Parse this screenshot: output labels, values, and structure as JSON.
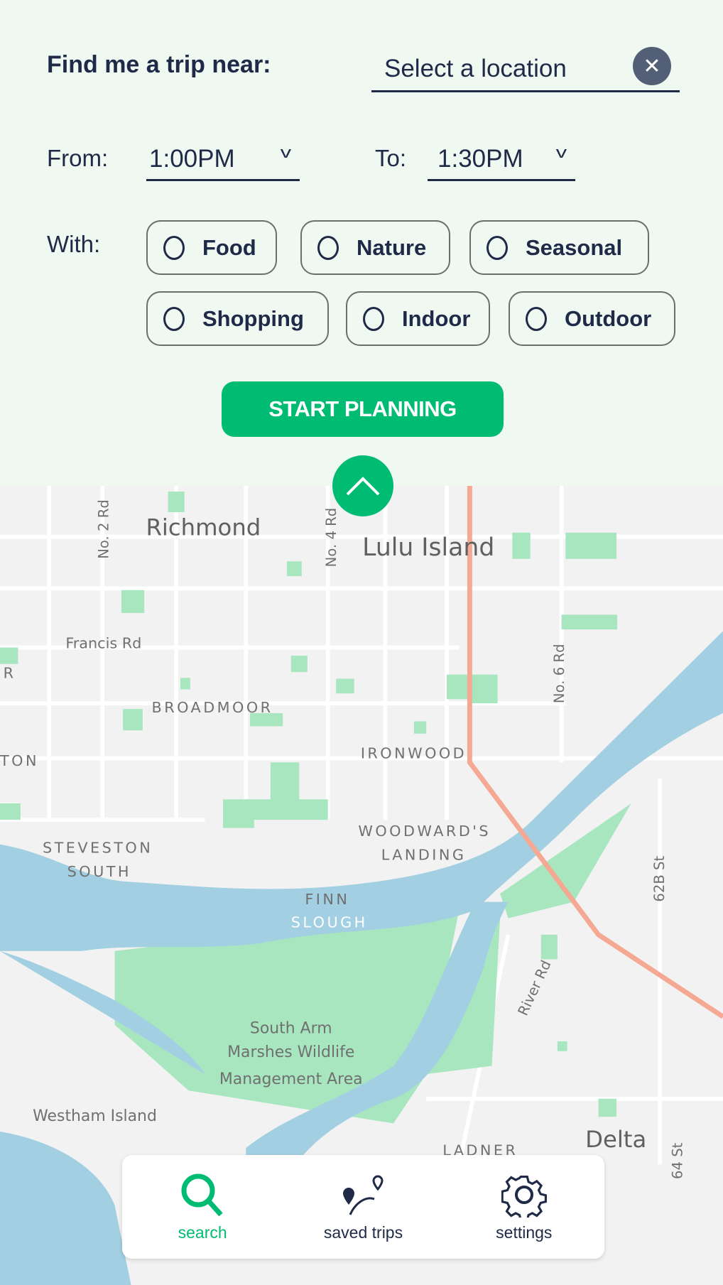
{
  "search": {
    "title": "Find me a trip near:",
    "location_placeholder": "Select a location",
    "clear_icon": "close-icon"
  },
  "time": {
    "from_label": "From:",
    "from_value": "1:00PM",
    "to_label": "To:",
    "to_value": "1:30PM"
  },
  "with": {
    "label": "With:",
    "options": [
      {
        "label": "Food",
        "selected": false
      },
      {
        "label": "Nature",
        "selected": false
      },
      {
        "label": "Seasonal",
        "selected": false
      },
      {
        "label": "Shopping",
        "selected": false
      },
      {
        "label": "Indoor",
        "selected": false
      },
      {
        "label": "Outdoor",
        "selected": false
      }
    ]
  },
  "start_button": "START PLANNING",
  "collapse_icon": "chevron-up-icon",
  "colors": {
    "accent": "#00bb72",
    "text": "#1e2a47",
    "panel": "#eff8f1",
    "water": "#a2cfe1",
    "park": "#a8e6c0",
    "highway": "#f5a892"
  },
  "map": {
    "labels": [
      "Richmond",
      "Lulu Island",
      "No. 2 Rd",
      "No. 4 Rd",
      "Francis Rd",
      "BROADMOOR",
      "IRONWOOD",
      "No. 6 Rd",
      "STEVESTON",
      "SOUTH",
      "WOODWARD'S",
      "LANDING",
      "FINN",
      "SLOUGH",
      "62B St",
      "River Rd",
      "South Arm",
      "Marshes Wildlife",
      "Management Area",
      "Westham Island",
      "LADNER",
      "Delta",
      "64 St",
      "TON",
      "R"
    ]
  },
  "nav": {
    "items": [
      {
        "label": "search",
        "icon": "search-icon",
        "active": true
      },
      {
        "label": "saved trips",
        "icon": "route-pins-icon",
        "active": false
      },
      {
        "label": "settings",
        "icon": "gear-icon",
        "active": false
      }
    ]
  }
}
